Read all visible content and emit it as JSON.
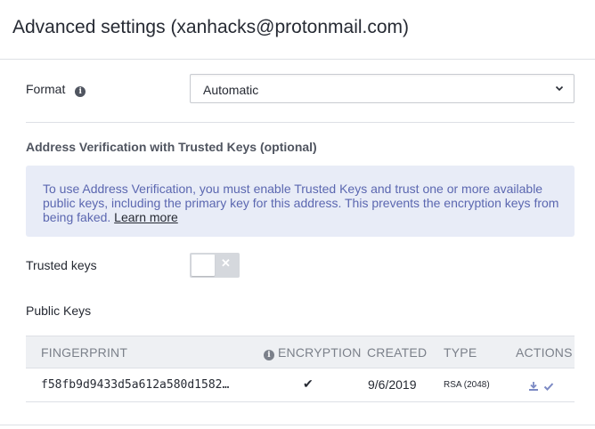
{
  "header": {
    "title": "Advanced settings (xanhacks@protonmail.com)"
  },
  "format": {
    "label": "Format",
    "selected": "Automatic"
  },
  "verification": {
    "section_title": "Address Verification with Trusted Keys (optional)",
    "alert_text": "To use Address Verification, you must enable Trusted Keys and trust one or more available public keys, including the primary key for this address. This prevents the encryption keys from being faked. ",
    "alert_link": "Learn more"
  },
  "trusted_keys": {
    "label": "Trusted keys",
    "toggle_off_symbol": "✕",
    "enabled": false
  },
  "public_keys": {
    "label": "Public Keys",
    "columns": {
      "fingerprint": "FINGERPRINT",
      "encryption": "ENCRYPTION",
      "created": "CREATED",
      "type": "TYPE",
      "actions": "ACTIONS"
    },
    "rows": [
      {
        "fingerprint": "f58fb9d9433d5a612a580d1582…",
        "encryption": "✔",
        "created": "9/6/2019",
        "type": "RSA (2048)"
      }
    ]
  },
  "colors": {
    "accent": "#5b67b0",
    "alert_bg": "#e8ecf7",
    "text": "#262a33"
  }
}
